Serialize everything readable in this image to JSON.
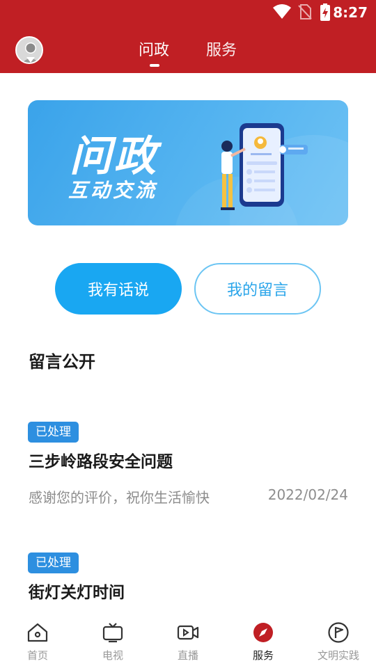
{
  "status_bar": {
    "time": "8:27",
    "icons": [
      "wifi-icon",
      "no-sim-icon",
      "battery-charging-icon"
    ]
  },
  "header": {
    "tabs": [
      {
        "label": "问政",
        "active": true
      },
      {
        "label": "服务",
        "active": false
      }
    ],
    "colors": {
      "background": "#c01f24"
    }
  },
  "banner": {
    "title": "问政",
    "subtitle": "互动交流"
  },
  "actions": {
    "primary": "我有话说",
    "secondary": "我的留言"
  },
  "section": {
    "title": "留言公开"
  },
  "messages": [
    {
      "status": "已处理",
      "title": "三步岭路段安全问题",
      "reply": "感谢您的评价，祝你生活愉快",
      "date": "2022/02/24"
    },
    {
      "status": "已处理",
      "title": "街灯关灯时间"
    }
  ],
  "bottom_nav": [
    {
      "label": "首页",
      "icon": "home-icon"
    },
    {
      "label": "电视",
      "icon": "tv-icon"
    },
    {
      "label": "直播",
      "icon": "video-camera-icon"
    },
    {
      "label": "服务",
      "icon": "compass-icon",
      "active": true
    },
    {
      "label": "文明实践",
      "icon": "flag-icon"
    }
  ],
  "colors": {
    "accent_blue": "#19a7f2",
    "badge_blue": "#2d8fe0",
    "active_red": "#c01f24"
  }
}
